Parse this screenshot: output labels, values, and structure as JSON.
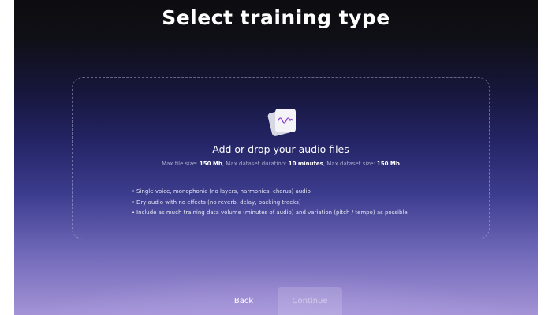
{
  "header": {
    "title": "Select training type"
  },
  "dropzone": {
    "icon": "audio-file-icon",
    "title": "Add or drop your audio files",
    "limits": {
      "file_size_label": "Max file size:",
      "file_size_value": "150 Mb",
      "duration_label": ", Max dataset duration:",
      "duration_value": "10 minutes",
      "dataset_size_label": ", Max dataset size:",
      "dataset_size_value": "150 Mb"
    },
    "requirements": [
      "Single-voice, monophonic (no layers, harmonies, chorus) audio",
      "Dry audio with no effects (no reverb, delay, backing tracks)",
      "Include as much training data volume (minutes of audio) and variation (pitch / tempo) as possible"
    ]
  },
  "footer": {
    "back_label": "Back",
    "continue_label": "Continue"
  },
  "colors": {
    "accent": "#8a3fd1",
    "text": "#ffffff"
  }
}
